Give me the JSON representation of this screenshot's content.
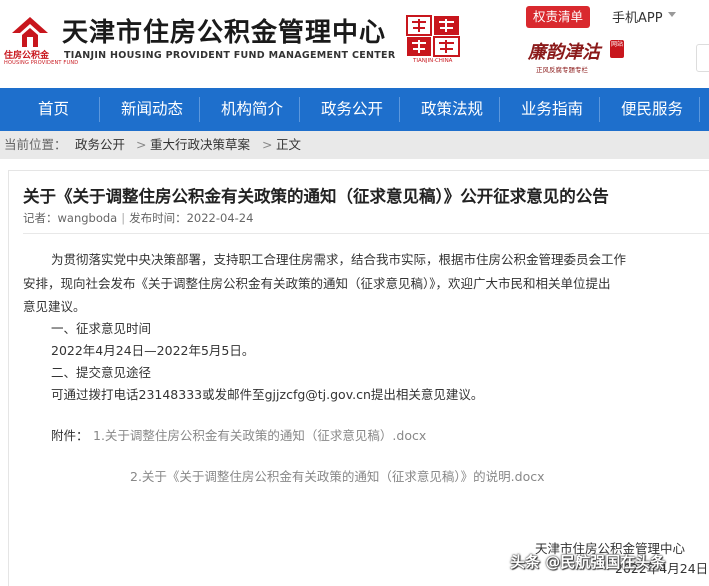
{
  "header": {
    "logo_small_cn": "住房公积金",
    "logo_small_en": "HOUSING PROVIDENT FUND",
    "title": "天津市住房公积金管理中心",
    "title_en": "TIANJIN HOUSING PROVIDENT FUND MANAGEMENT CENTER",
    "seal_caption": "TIANJIN·CHINA",
    "power_list_label": "权责清单",
    "app_label": "手机APP",
    "promo_main": "廉韵津沽",
    "promo_badge": "网站",
    "promo_sub": "正风反腐专題专栏"
  },
  "nav": {
    "items": [
      {
        "label": "首页"
      },
      {
        "label": "新闻动态"
      },
      {
        "label": "机构简介"
      },
      {
        "label": "政务公开"
      },
      {
        "label": "政策法规"
      },
      {
        "label": "业务指南"
      },
      {
        "label": "便民服务"
      }
    ]
  },
  "breadcrumb": {
    "prefix": "当前位置：",
    "items": [
      "政务公开",
      "重大行政决策草案",
      "正文"
    ],
    "separator": ">"
  },
  "article": {
    "title": "关于《关于调整住房公积金有关政策的通知（征求意见稿）》公开征求意见的公告",
    "author_label": "记者：wangboda",
    "date_label": "发布时间：2022-04-24",
    "para1_line1": "为贯彻落实党中央决策部署，支持职工合理住房需求，结合我市实际，根据市住房公积金管理委员会工作",
    "para1_line2": "安排，现向社会发布《关于调整住房公积金有关政策的通知（征求意见稿）》，欢迎广大市民和相关单位提出",
    "para1_line3": "意见建议。",
    "sec1_heading": "一、征求意见时间",
    "sec1_body": "2022年4月24日—2022年5月5日。",
    "sec2_heading": "二、提交意见途径",
    "sec2_body": "可通过拨打电话23148333或发邮件至gjjzcfg@tj.gov.cn提出相关意见建议。",
    "attach_prefix": "附件：",
    "attach1": "1.关于调整住房公积金有关政策的通知（征求意见稿）.docx",
    "attach2": "2.关于《关于调整住房公积金有关政策的通知（征求意见稿）》的说明.docx",
    "footer_org": "天津市住房公积金管理中心",
    "footer_date": "2022年4月24日"
  },
  "watermark": "头条 @民航强国在头条",
  "colors": {
    "nav_bg": "#1e6fcc",
    "brand_red": "#c8161d",
    "button_red": "#d9292e",
    "crumb_bg": "#e9e9e9"
  }
}
